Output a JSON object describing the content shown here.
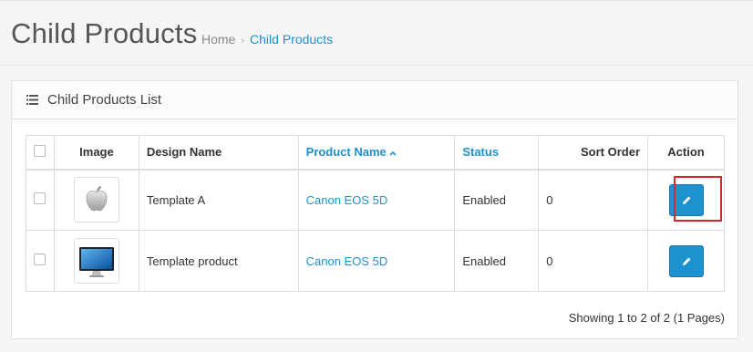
{
  "header": {
    "title": "Child Products",
    "breadcrumb": [
      {
        "label": "Home"
      },
      {
        "label": "Child Products"
      }
    ],
    "breadcrumb_separator": "›"
  },
  "panel": {
    "title": "Child Products List",
    "icon": "list-icon"
  },
  "table": {
    "columns": {
      "image": "Image",
      "design_name": "Design Name",
      "product_name": "Product Name",
      "status": "Status",
      "sort_order": "Sort Order",
      "action": "Action"
    },
    "sorted_by": "Product Name",
    "sort_direction": "ascending",
    "rows": [
      {
        "image": "apple-logo-thumbnail",
        "design_name": "Template A",
        "product_name": "Canon EOS 5D",
        "status": "Enabled",
        "sort_order": "0",
        "action": "edit-icon"
      },
      {
        "image": "monitor-thumbnail",
        "design_name": "Template product",
        "product_name": "Canon EOS 5D",
        "status": "Enabled",
        "sort_order": "0",
        "action": "edit-icon"
      }
    ]
  },
  "pagination": {
    "info": "Showing 1 to 2 of 2 (1 Pages)"
  },
  "colors": {
    "accent": "#1e91cf",
    "highlight": "#d9262c",
    "background": "#f5f5f5"
  }
}
